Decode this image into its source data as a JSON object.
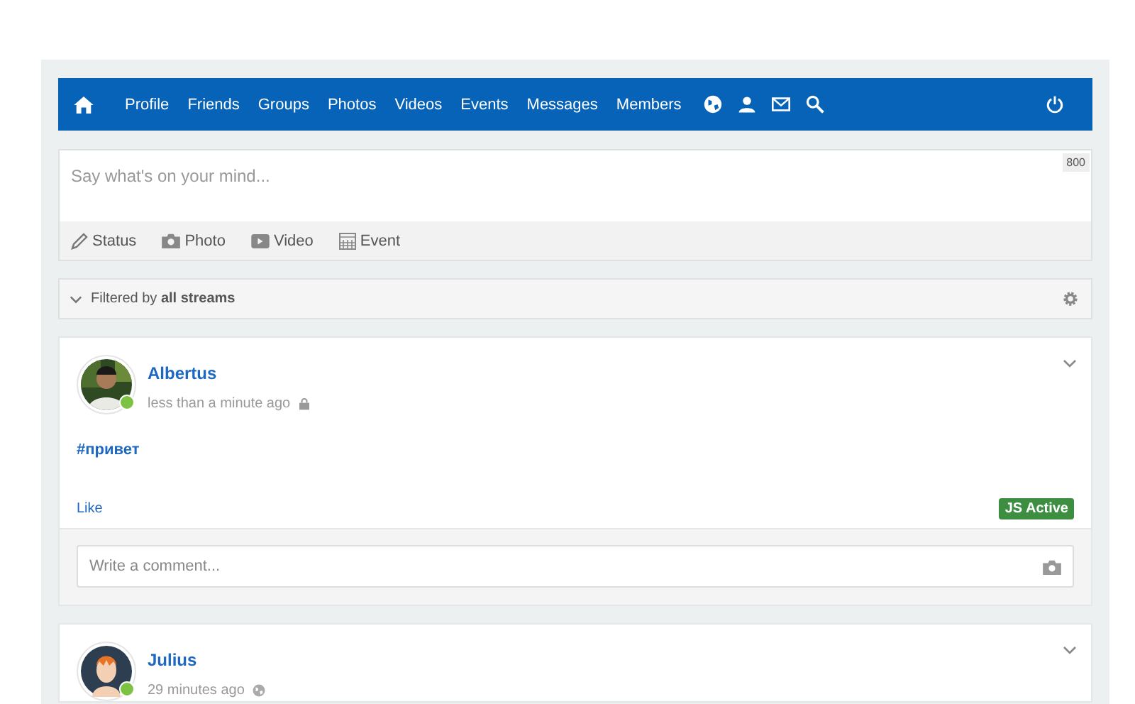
{
  "navbar": {
    "links": [
      "Profile",
      "Friends",
      "Groups",
      "Photos",
      "Videos",
      "Events",
      "Messages",
      "Members"
    ]
  },
  "composer": {
    "placeholder": "Say what's on your mind...",
    "counter": "800",
    "types": [
      {
        "kind": "status",
        "label": "Status"
      },
      {
        "label": "Photo"
      },
      {
        "kind": "video",
        "label": "Video"
      },
      {
        "kind": "event",
        "label": "Event"
      }
    ]
  },
  "filter": {
    "text": "Filtered by **all streams**"
  },
  "posts": [
    {
      "author": "Albertus",
      "online": true,
      "time": "less than a minute ago",
      "private": true,
      "body": "#привет",
      "like": "Like",
      "badge": "JS Active",
      "comment_placeholder": "Write a comment..."
    },
    {
      "author": "Julius",
      "avatar": {
        "kind": "icon"
      },
      "online": true,
      "time": "29 minutes ago",
      "private": false
    }
  ]
}
